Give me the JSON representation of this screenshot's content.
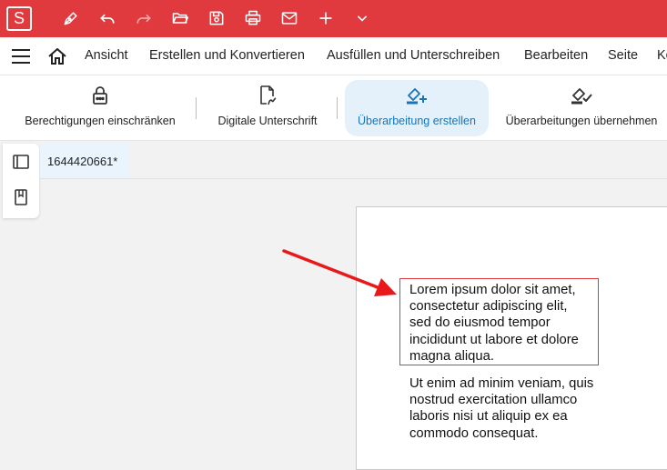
{
  "app": {
    "logo_letter": "S",
    "accent": "#e03a3e"
  },
  "quick_toolbar": {
    "icons": [
      "pen-icon",
      "undo-icon",
      "redo-icon",
      "open-folder-icon",
      "save-icon",
      "print-icon",
      "mail-icon",
      "plus-icon",
      "chevron-down-icon"
    ]
  },
  "menu": {
    "items": [
      "Ansicht",
      "Erstellen und Konvertieren",
      "Ausfüllen und Unterschreiben",
      "Bearbeiten",
      "Seite",
      "Ko"
    ]
  },
  "ribbon": {
    "buttons": [
      {
        "label": "Berechtigungen einschränken",
        "icon": "lock-icon",
        "active": false
      },
      {
        "label": "Digitale Unterschrift",
        "icon": "signature-document-icon",
        "active": false
      },
      {
        "label": "Überarbeitung erstellen",
        "icon": "redaction-create-icon",
        "active": true
      },
      {
        "label": "Überarbeitungen übernehmen",
        "icon": "redaction-apply-icon",
        "active": false
      }
    ]
  },
  "side_panel": {
    "icons": [
      "panel-toggle-icon",
      "bookmark-icon"
    ]
  },
  "document": {
    "tab_title": "1644420661*",
    "paragraph1": "Lorem ipsum dolor sit amet,\nconsectetur adipiscing elit,\nsed do eiusmod tempor\nincididunt ut labore et dolore\nmagna aliqua.",
    "paragraph2": "Ut enim ad minim veniam, quis\nnostrud exercitation ullamco\nlaboris nisi ut aliquip ex ea\ncommodo consequat."
  },
  "colors": {
    "highlight_border": "#e03a3e",
    "arrow": "#e8191a",
    "active_button_bg": "#e4f1fb",
    "active_button_text": "#1a73b5"
  }
}
